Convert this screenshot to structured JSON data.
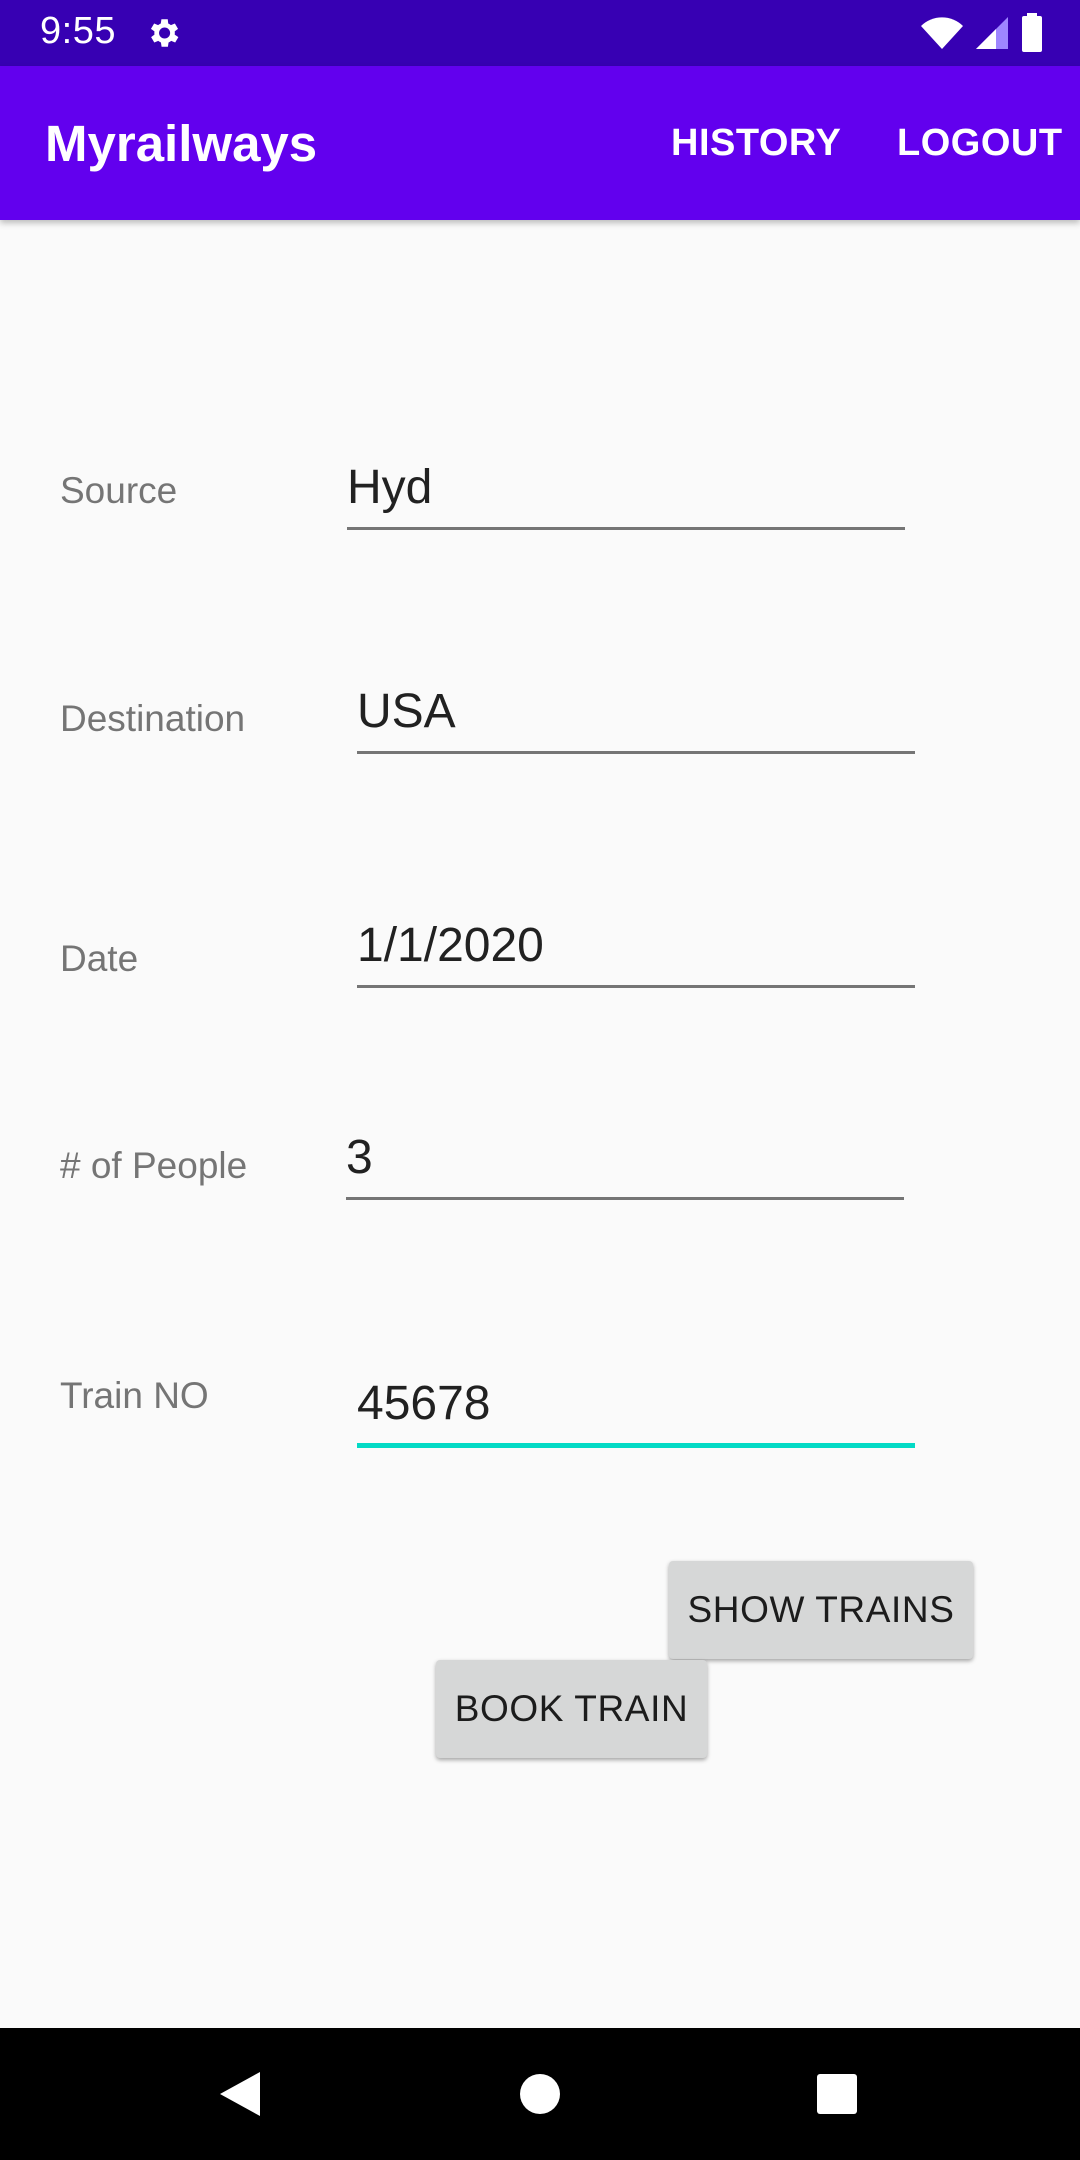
{
  "status_bar": {
    "time": "9:55",
    "icons": [
      "gear-icon",
      "wifi-icon",
      "signal-icon",
      "battery-icon"
    ]
  },
  "app_bar": {
    "title": "Myrailways",
    "actions": {
      "history": "HISTORY",
      "logout": "LOGOUT"
    },
    "color": "#6200ee",
    "status_color": "#3700b3"
  },
  "form": {
    "source": {
      "label": "Source",
      "value": "Hyd"
    },
    "destination": {
      "label": "Destination",
      "value": "USA"
    },
    "date": {
      "label": "Date",
      "value": "1/1/2020"
    },
    "people": {
      "label": "# of People",
      "value": "3"
    },
    "train_no": {
      "label": "Train NO",
      "value": "45678"
    },
    "focus_color": "#03dac5"
  },
  "buttons": {
    "show_trains": "SHOW TRAINS",
    "book_train": "BOOK TRAIN"
  },
  "nav_bar": {
    "icons": [
      "back-icon",
      "home-icon",
      "recents-icon"
    ]
  }
}
